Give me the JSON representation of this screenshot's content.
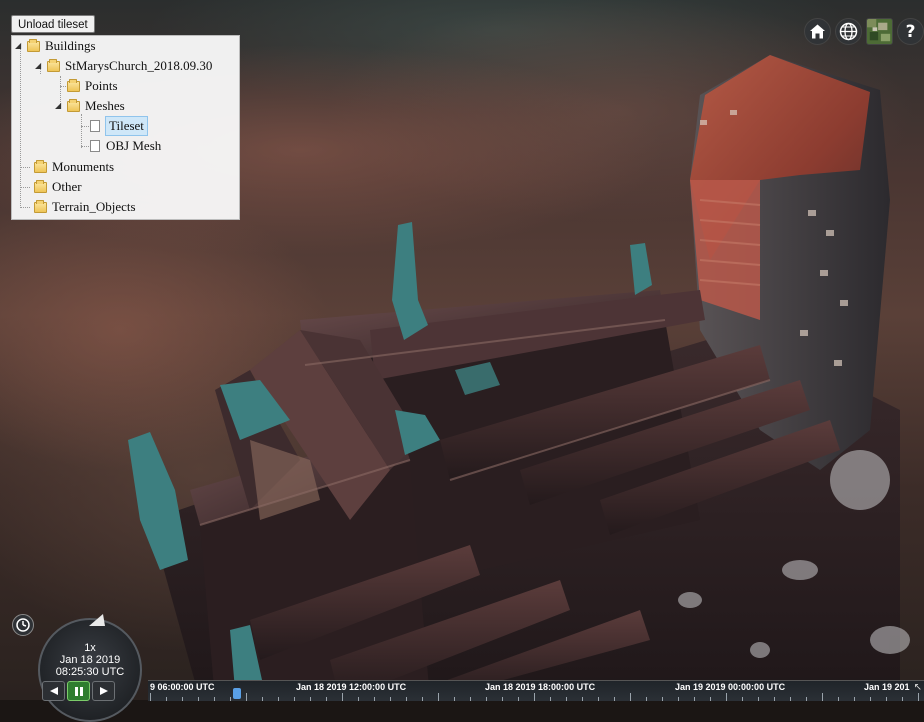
{
  "unload_button": {
    "label": "Unload tileset"
  },
  "tree": {
    "items": [
      {
        "label": "Buildings"
      },
      {
        "label": "StMarysChurch_2018.09.30"
      },
      {
        "label": "Points"
      },
      {
        "label": "Meshes"
      },
      {
        "label": "Tileset",
        "selected": true
      },
      {
        "label": "OBJ Mesh"
      },
      {
        "label": "Monuments"
      },
      {
        "label": "Other"
      },
      {
        "label": "Terrain_Objects"
      }
    ]
  },
  "toolbar": {
    "home_icon": "home-icon",
    "scene_mode_icon": "globe-icon",
    "imagery_icon": "imagery-picker-icon",
    "help_label": "?"
  },
  "animation": {
    "speed": "1x",
    "date": "Jan 18 2019",
    "time": "08:25:30 UTC"
  },
  "timeline": {
    "labels": [
      "9 06:00:00 UTC",
      "Jan 18 2019 12:00:00 UTC",
      "Jan 18 2019 18:00:00 UTC",
      "Jan 19 2019 00:00:00 UTC",
      "Jan 19 201"
    ]
  },
  "colors": {
    "roof_red": "#a04535",
    "mesh_brown": "#4a3434",
    "teal": "#3d7f80",
    "selection_blue": "#cfe7f8"
  }
}
